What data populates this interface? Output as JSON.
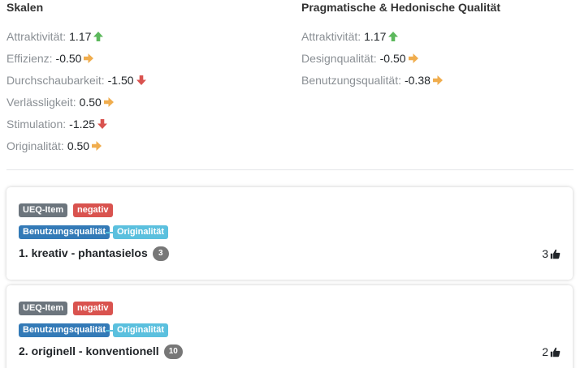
{
  "colors": {
    "up": "#5cb85c",
    "right": "#f0ad4e",
    "down": "#d9534f"
  },
  "scales": {
    "heading": "Skalen",
    "items": [
      {
        "label": "Attraktivität:",
        "value": "1.17",
        "trend": "up"
      },
      {
        "label": "Effizienz:",
        "value": "-0.50",
        "trend": "right"
      },
      {
        "label": "Durchschaubarkeit:",
        "value": "-1.50",
        "trend": "down"
      },
      {
        "label": "Verlässligkeit:",
        "value": "0.50",
        "trend": "right"
      },
      {
        "label": "Stimulation:",
        "value": "-1.25",
        "trend": "down"
      },
      {
        "label": "Originalität:",
        "value": "0.50",
        "trend": "right"
      }
    ]
  },
  "quality": {
    "heading": "Pragmatische & Hedonische Qualität",
    "items": [
      {
        "label": "Attraktivität:",
        "value": "1.17",
        "trend": "up"
      },
      {
        "label": "Designqualität:",
        "value": "-0.50",
        "trend": "right"
      },
      {
        "label": "Benutzungsqualität:",
        "value": "-0.38",
        "trend": "right"
      }
    ]
  },
  "cards": [
    {
      "type_badge": "UEQ-Item",
      "polarity_badge": "negativ",
      "category_badge": "Benutzungsqualität",
      "scale_badge": "Originalität",
      "title": "1. kreativ - phantasielos",
      "count": "3",
      "votes": "3",
      "vote_icon": "thumbs-up-icon"
    },
    {
      "type_badge": "UEQ-Item",
      "polarity_badge": "negativ",
      "category_badge": "Benutzungsqualität",
      "scale_badge": "Originalität",
      "title": "2. originell - konventionell",
      "count": "10",
      "votes": "2",
      "vote_icon": "thumbs-up-icon"
    }
  ]
}
